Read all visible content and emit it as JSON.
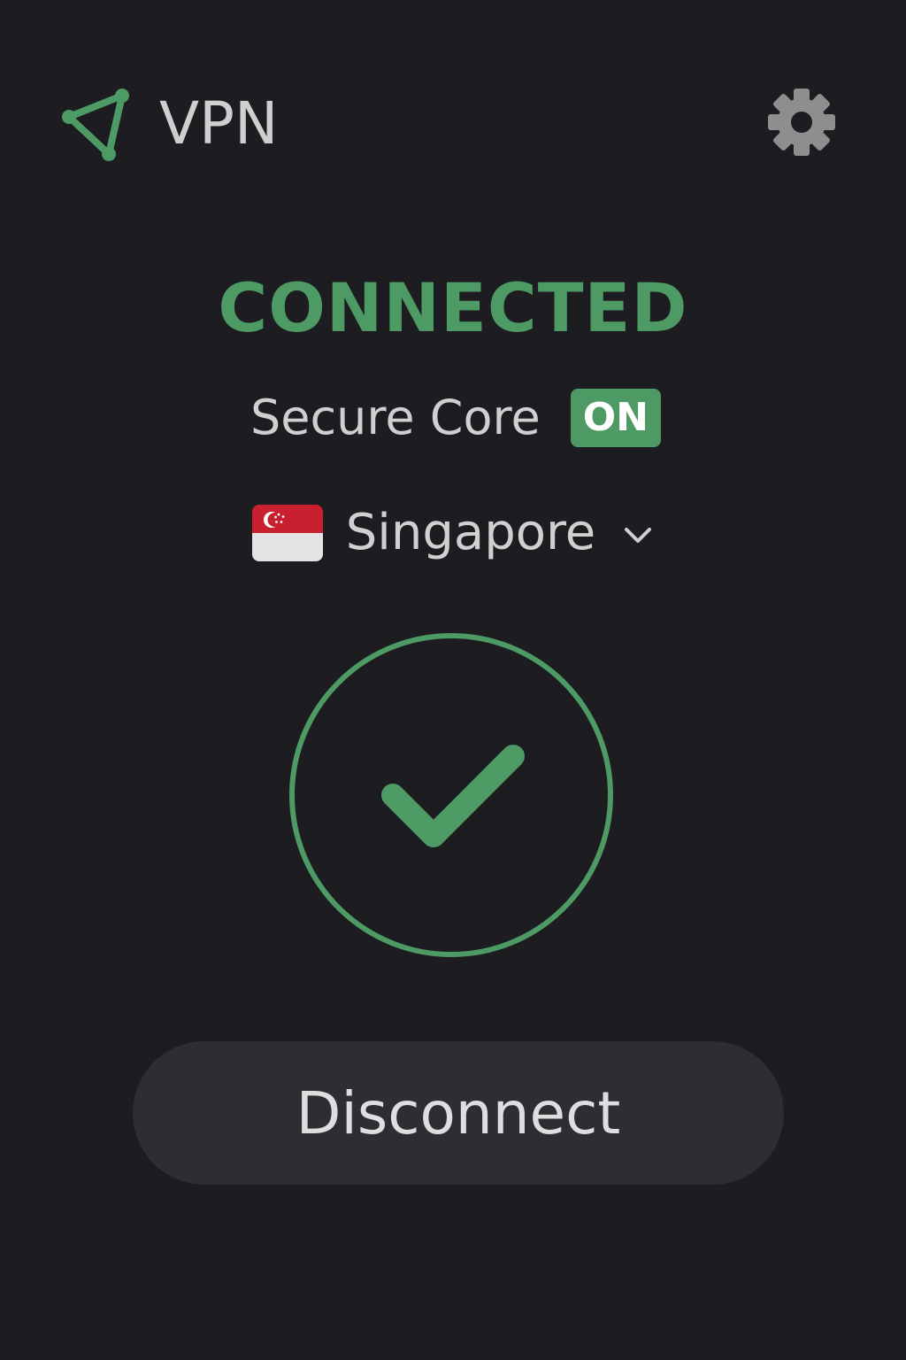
{
  "header": {
    "app_title": "VPN",
    "logo_icon": "triangle-node-logo-icon",
    "settings_icon": "gear-icon"
  },
  "status": {
    "text": "CONNECTED",
    "color": "#4e9a64"
  },
  "secure_core": {
    "label": "Secure Core",
    "toggle_label": "ON",
    "toggle_color": "#4e9a64"
  },
  "location": {
    "country": "Singapore",
    "flag_icon": "singapore-flag-icon",
    "dropdown_icon": "chevron-down-icon"
  },
  "status_indicator": {
    "icon": "checkmark-circle-icon",
    "color": "#4e9a64"
  },
  "actions": {
    "disconnect_label": "Disconnect"
  },
  "colors": {
    "background": "#1d1c21",
    "accent": "#4e9a64",
    "button_background": "#2e2d33"
  }
}
